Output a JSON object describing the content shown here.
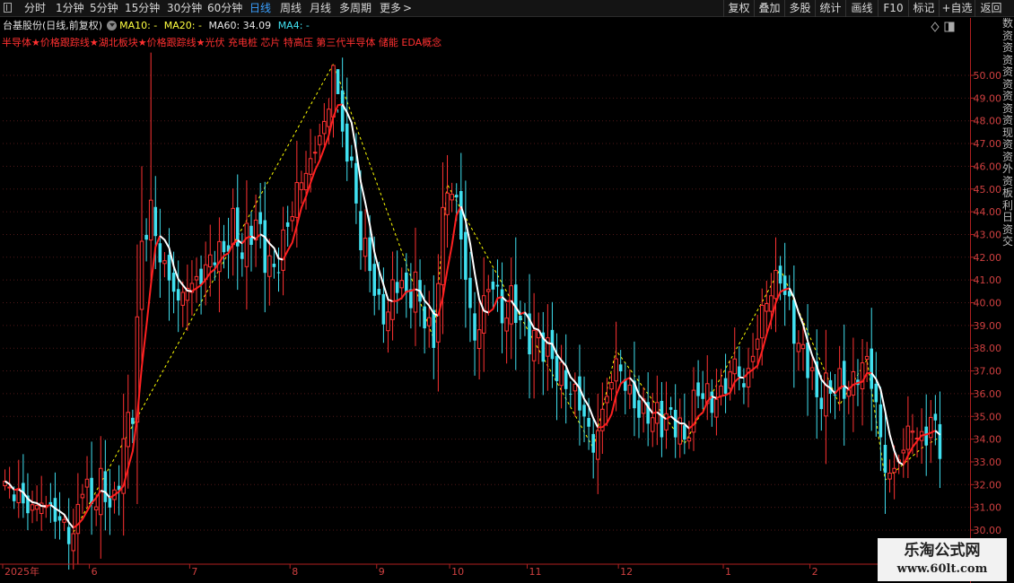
{
  "toolbar": {
    "left_items": [
      "分时",
      "1分钟",
      "5分钟",
      "15分钟",
      "30分钟",
      "60分钟",
      "日线",
      "周线",
      "月线",
      "多周期",
      "更多"
    ],
    "active": "日线",
    "more_suffix": ">",
    "right_items": [
      "复权",
      "叠加",
      "多股",
      "统计",
      "画线",
      "F10",
      "标记",
      "+自选",
      "返回"
    ]
  },
  "info": {
    "stock": "台基股份(日线,前复权)",
    "ma10": "MA10: -",
    "ma20": "MA20: -",
    "ma60": "MA60: 34.09",
    "ma4": "MA4: -"
  },
  "tags": "半导体★价格跟踪线★湖北板块★价格跟踪线★光伏 充电桩 芯片 特高压 第三代半导体 储能 EDA概念",
  "side_panel_chars": [
    "数",
    "资",
    "资",
    "资",
    "资",
    "资",
    "资",
    "资",
    "资",
    "现",
    "资",
    "资",
    "外",
    "资",
    "板",
    "利",
    "日",
    "资",
    "交"
  ],
  "colors": {
    "up": "#ff3232",
    "down": "#40e0f0",
    "ma_white": "#ffffff",
    "ma_red": "#ff2020",
    "zigzag": "#ffff00",
    "grid": "#501818",
    "axis_text": "#d04040",
    "accent": "#3aa0ff"
  },
  "chart_data": {
    "type": "candlestick",
    "y_ticks": [
      30.0,
      31.0,
      32.0,
      33.0,
      34.0,
      35.0,
      36.0,
      37.0,
      38.0,
      39.0,
      40.0,
      41.0,
      42.0,
      43.0,
      44.0,
      45.0,
      46.0,
      47.0,
      48.0,
      49.0,
      50.0
    ],
    "y_tick_labels": [
      "30.00",
      "31.00",
      "32.00",
      "33.00",
      "34.00",
      "35.00",
      "36.00",
      "37.00",
      "38.00",
      "39.00",
      "40.00",
      "41.00",
      "42.00",
      "43.00",
      "44.00",
      "45.00",
      "46.00",
      "47.00",
      "48.00",
      "49.00",
      "50.00"
    ],
    "ylim": [
      29.2,
      51.0
    ],
    "month_labels": [
      "2025年",
      "6",
      "7",
      "8",
      "9",
      "10",
      "11",
      "12",
      "1",
      "2"
    ],
    "month_start_index": [
      0,
      19,
      41,
      63,
      82,
      98,
      115,
      135,
      158,
      177
    ],
    "num_bars": 206,
    "anchors": [
      [
        0,
        31.8
      ],
      [
        5,
        31.0
      ],
      [
        8,
        31.4
      ],
      [
        11,
        30.4
      ],
      [
        15,
        29.8
      ],
      [
        17,
        32.3
      ],
      [
        19,
        31.0
      ],
      [
        21,
        31.8
      ],
      [
        24,
        31.2
      ],
      [
        26,
        34.0
      ],
      [
        28,
        35.2
      ],
      [
        30,
        42.4
      ],
      [
        32,
        44.2
      ],
      [
        34,
        42.2
      ],
      [
        36,
        41.0
      ],
      [
        38,
        39.8
      ],
      [
        40,
        40.8
      ],
      [
        43,
        41.3
      ],
      [
        46,
        42.0
      ],
      [
        48,
        42.1
      ],
      [
        50,
        43.6
      ],
      [
        52,
        42.4
      ],
      [
        55,
        43.4
      ],
      [
        57,
        42.0
      ],
      [
        59,
        41.5
      ],
      [
        61,
        42.8
      ],
      [
        63,
        44.0
      ],
      [
        65,
        45.3
      ],
      [
        67,
        46.2
      ],
      [
        69,
        47.6
      ],
      [
        71,
        48.4
      ],
      [
        72,
        50.5
      ],
      [
        74,
        47.2
      ],
      [
        76,
        46.0
      ],
      [
        78,
        43.0
      ],
      [
        80,
        41.6
      ],
      [
        82,
        39.4
      ],
      [
        84,
        39.6
      ],
      [
        86,
        41.4
      ],
      [
        88,
        40.2
      ],
      [
        90,
        40.6
      ],
      [
        92,
        39.2
      ],
      [
        94,
        38.4
      ],
      [
        96,
        44.0
      ],
      [
        97,
        45.1
      ],
      [
        99,
        44.3
      ],
      [
        101,
        41.0
      ],
      [
        103,
        38.4
      ],
      [
        105,
        40.2
      ],
      [
        107,
        40.9
      ],
      [
        109,
        39.1
      ],
      [
        111,
        40.1
      ],
      [
        113,
        39.5
      ],
      [
        115,
        38.5
      ],
      [
        117,
        38.2
      ],
      [
        120,
        37.6
      ],
      [
        123,
        36.6
      ],
      [
        126,
        35.4
      ],
      [
        129,
        33.7
      ],
      [
        131,
        35.4
      ],
      [
        134,
        37.2
      ],
      [
        136,
        36.3
      ],
      [
        138,
        35.6
      ],
      [
        141,
        35.2
      ],
      [
        144,
        34.6
      ],
      [
        147,
        35.0
      ],
      [
        149,
        34.1
      ],
      [
        152,
        36.0
      ],
      [
        155,
        35.6
      ],
      [
        158,
        36.5
      ],
      [
        160,
        37.3
      ],
      [
        162,
        36.1
      ],
      [
        164,
        37.7
      ],
      [
        166,
        39.8
      ],
      [
        168,
        40.6
      ],
      [
        170,
        41.0
      ],
      [
        172,
        39.6
      ],
      [
        174,
        38.2
      ],
      [
        176,
        37.6
      ],
      [
        178,
        35.6
      ],
      [
        180,
        36.0
      ],
      [
        183,
        36.6
      ],
      [
        185,
        36.3
      ],
      [
        187,
        36.7
      ],
      [
        189,
        37.3
      ],
      [
        191,
        35.6
      ],
      [
        193,
        32.8
      ],
      [
        195,
        32.5
      ],
      [
        197,
        33.5
      ],
      [
        199,
        34.6
      ],
      [
        201,
        34.0
      ],
      [
        203,
        34.9
      ],
      [
        205,
        33.7
      ]
    ],
    "spikes": {
      "30": 46.0,
      "32": 51.0,
      "71": 49.0,
      "72": 50.4,
      "73": 48.5
    },
    "zigzag": [
      [
        15,
        29.9
      ],
      [
        72,
        50.5
      ],
      [
        94,
        38.4
      ],
      [
        97,
        45.2
      ],
      [
        129,
        33.6
      ],
      [
        134,
        37.9
      ],
      [
        149,
        33.8
      ],
      [
        170,
        41.5
      ],
      [
        183,
        35.5
      ],
      [
        189,
        37.5
      ],
      [
        193,
        32.2
      ],
      [
        201,
        33.6
      ],
      [
        205,
        34.1
      ]
    ]
  }
}
